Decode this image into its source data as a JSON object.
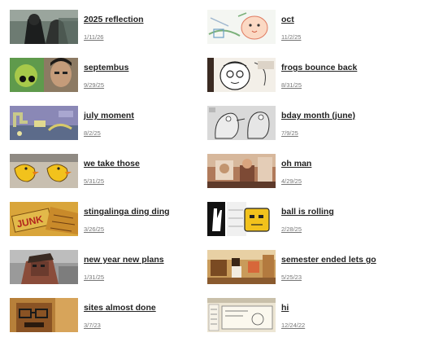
{
  "posts": [
    {
      "title": "2025 reflection",
      "date": "1/11/26",
      "thumb": "reflection-thumbnail"
    },
    {
      "title": "oct",
      "date": "11/2/25",
      "thumb": "oct-thumbnail"
    },
    {
      "title": "septembus",
      "date": "9/29/25",
      "thumb": "septembus-thumbnail"
    },
    {
      "title": "frogs bounce back",
      "date": "8/31/25",
      "thumb": "frogs-thumbnail"
    },
    {
      "title": "july moment",
      "date": "8/2/25",
      "thumb": "july-thumbnail"
    },
    {
      "title": "bday month (june)",
      "date": "7/9/25",
      "thumb": "bday-thumbnail"
    },
    {
      "title": "we take those",
      "date": "5/31/25",
      "thumb": "ducks-thumbnail"
    },
    {
      "title": "oh man",
      "date": "4/29/25",
      "thumb": "ohman-thumbnail"
    },
    {
      "title": "stingalinga ding ding",
      "date": "3/26/25",
      "thumb": "junk-thumbnail"
    },
    {
      "title": "ball is rolling",
      "date": "2/28/25",
      "thumb": "ball-thumbnail"
    },
    {
      "title": "new year new plans",
      "date": "1/31/25",
      "thumb": "newyear-thumbnail"
    },
    {
      "title": "semester ended lets go",
      "date": "5/25/23",
      "thumb": "semester-thumbnail"
    },
    {
      "title": "sites almost done",
      "date": "3/7/23",
      "thumb": "sites-thumbnail"
    },
    {
      "title": "hi",
      "date": "12/24/22",
      "thumb": "hi-thumbnail"
    }
  ]
}
